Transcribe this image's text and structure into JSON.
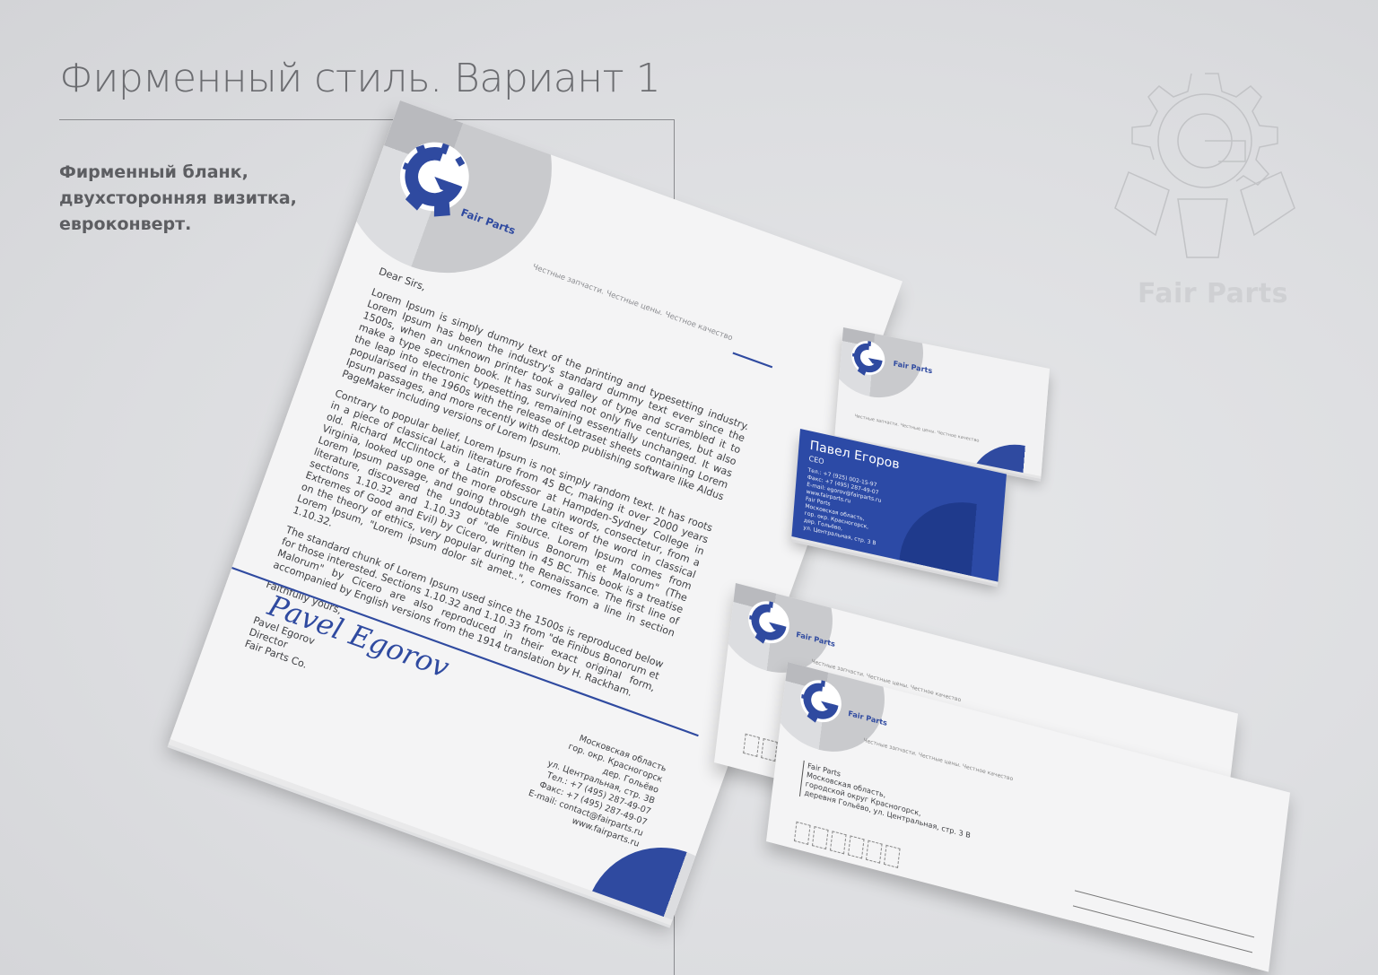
{
  "header": {
    "title": "Фирменный стиль. Вариант 1",
    "subtitle": [
      "Фирменный бланк,",
      "двухсторонняя визитка,",
      "евроконверт."
    ]
  },
  "watermark": {
    "text": "Fair Parts",
    "icon": "gear-logo-icon"
  },
  "brand": {
    "name": "Fair Parts",
    "tagline": "Честные запчасти. Честные цены. Честное качество",
    "accent_color": "#2f4aa0",
    "gray_color": "#c9cacd"
  },
  "letterhead": {
    "greeting": "Dear Sirs,",
    "paragraphs": [
      "Lorem Ipsum is simply dummy text of the printing and typesetting industry. Lorem Ipsum has been the industry's standard dummy text ever since the 1500s, when an unknown printer took a galley of type and scrambled it to make a type specimen book. It has survived not only five centuries, but also the leap into electronic typesetting, remaining essentially unchanged. It was popularised in the 1960s with the release of Letraset sheets containing Lorem Ipsum passages, and more recently with desktop publishing software like Aldus PageMaker including versions of Lorem Ipsum.",
      "Contrary to popular belief, Lorem Ipsum is not simply random text. It has roots in a piece of classical Latin literature from 45 BC, making it over 2000 years old. Richard McClintock, a Latin professor at Hampden-Sydney College in Virginia, looked up one of the more obscure Latin words, consectetur, from a Lorem Ipsum passage, and going through the cites of the word in classical literature, discovered the undoubtable source. Lorem Ipsum comes from sections 1.10.32 and 1.10.33 of \"de Finibus Bonorum et Malorum\" (The Extremes of Good and Evil) by Cicero, written in 45 BC. This book is a treatise on the theory of ethics, very popular during the Renaissance. The first line of Lorem Ipsum, \"Lorem ipsum dolor sit amet..\", comes from a line in section 1.10.32.",
      "The standard chunk of Lorem Ipsum used since the 1500s is reproduced below for those interested. Sections 1.10.32 and 1.10.33 from \"de Finibus Bonorum et Malorum\" by Cicero are also reproduced in their exact original form, accompanied by English versions from the 1914 translation by H. Rackham."
    ],
    "closing": "Faithfully yours,",
    "signature": "Pavel Egorov",
    "signer_name": "Pavel Egorov",
    "signer_role": "Director",
    "signer_company": "Fair Parts Co.",
    "address": [
      "Московская область",
      "гор. окр. Красногорск",
      "дер. Гольёво",
      "ул. Центральная, стр. 3В",
      "Тел.: +7 (495) 287-49-07",
      "Факс: +7 (495) 287-49-07",
      "E-mail: contact@fairparts.ru",
      "www.fairparts.ru"
    ]
  },
  "business_card": {
    "front_brand": "Fair Parts",
    "front_tagline": "Честные запчасти. Честные цены. Честное качество",
    "name": "Павел Егоров",
    "role": "CEO",
    "contacts": [
      "Тел.: +7 (925) 002-15-97",
      "Факс: +7 (495) 287-49-07",
      "E-mail: egorov@fairparts.ru",
      "www.fairparts.ru",
      "Fair Parts",
      "Московская область,",
      "гор. окр. Красногорск,",
      "дер. Гольёво,",
      "ул. Центральная, стр. 3 В"
    ]
  },
  "envelope": {
    "brand": "Fair Parts",
    "tagline": "Честные запчасти. Честные цены. Честное качество",
    "return_address": [
      "Fair Parts",
      "Московская область,",
      "городской округ Красногорск,",
      "деревня Гольёво, ул. Центральная, стр. 3 В"
    ]
  }
}
